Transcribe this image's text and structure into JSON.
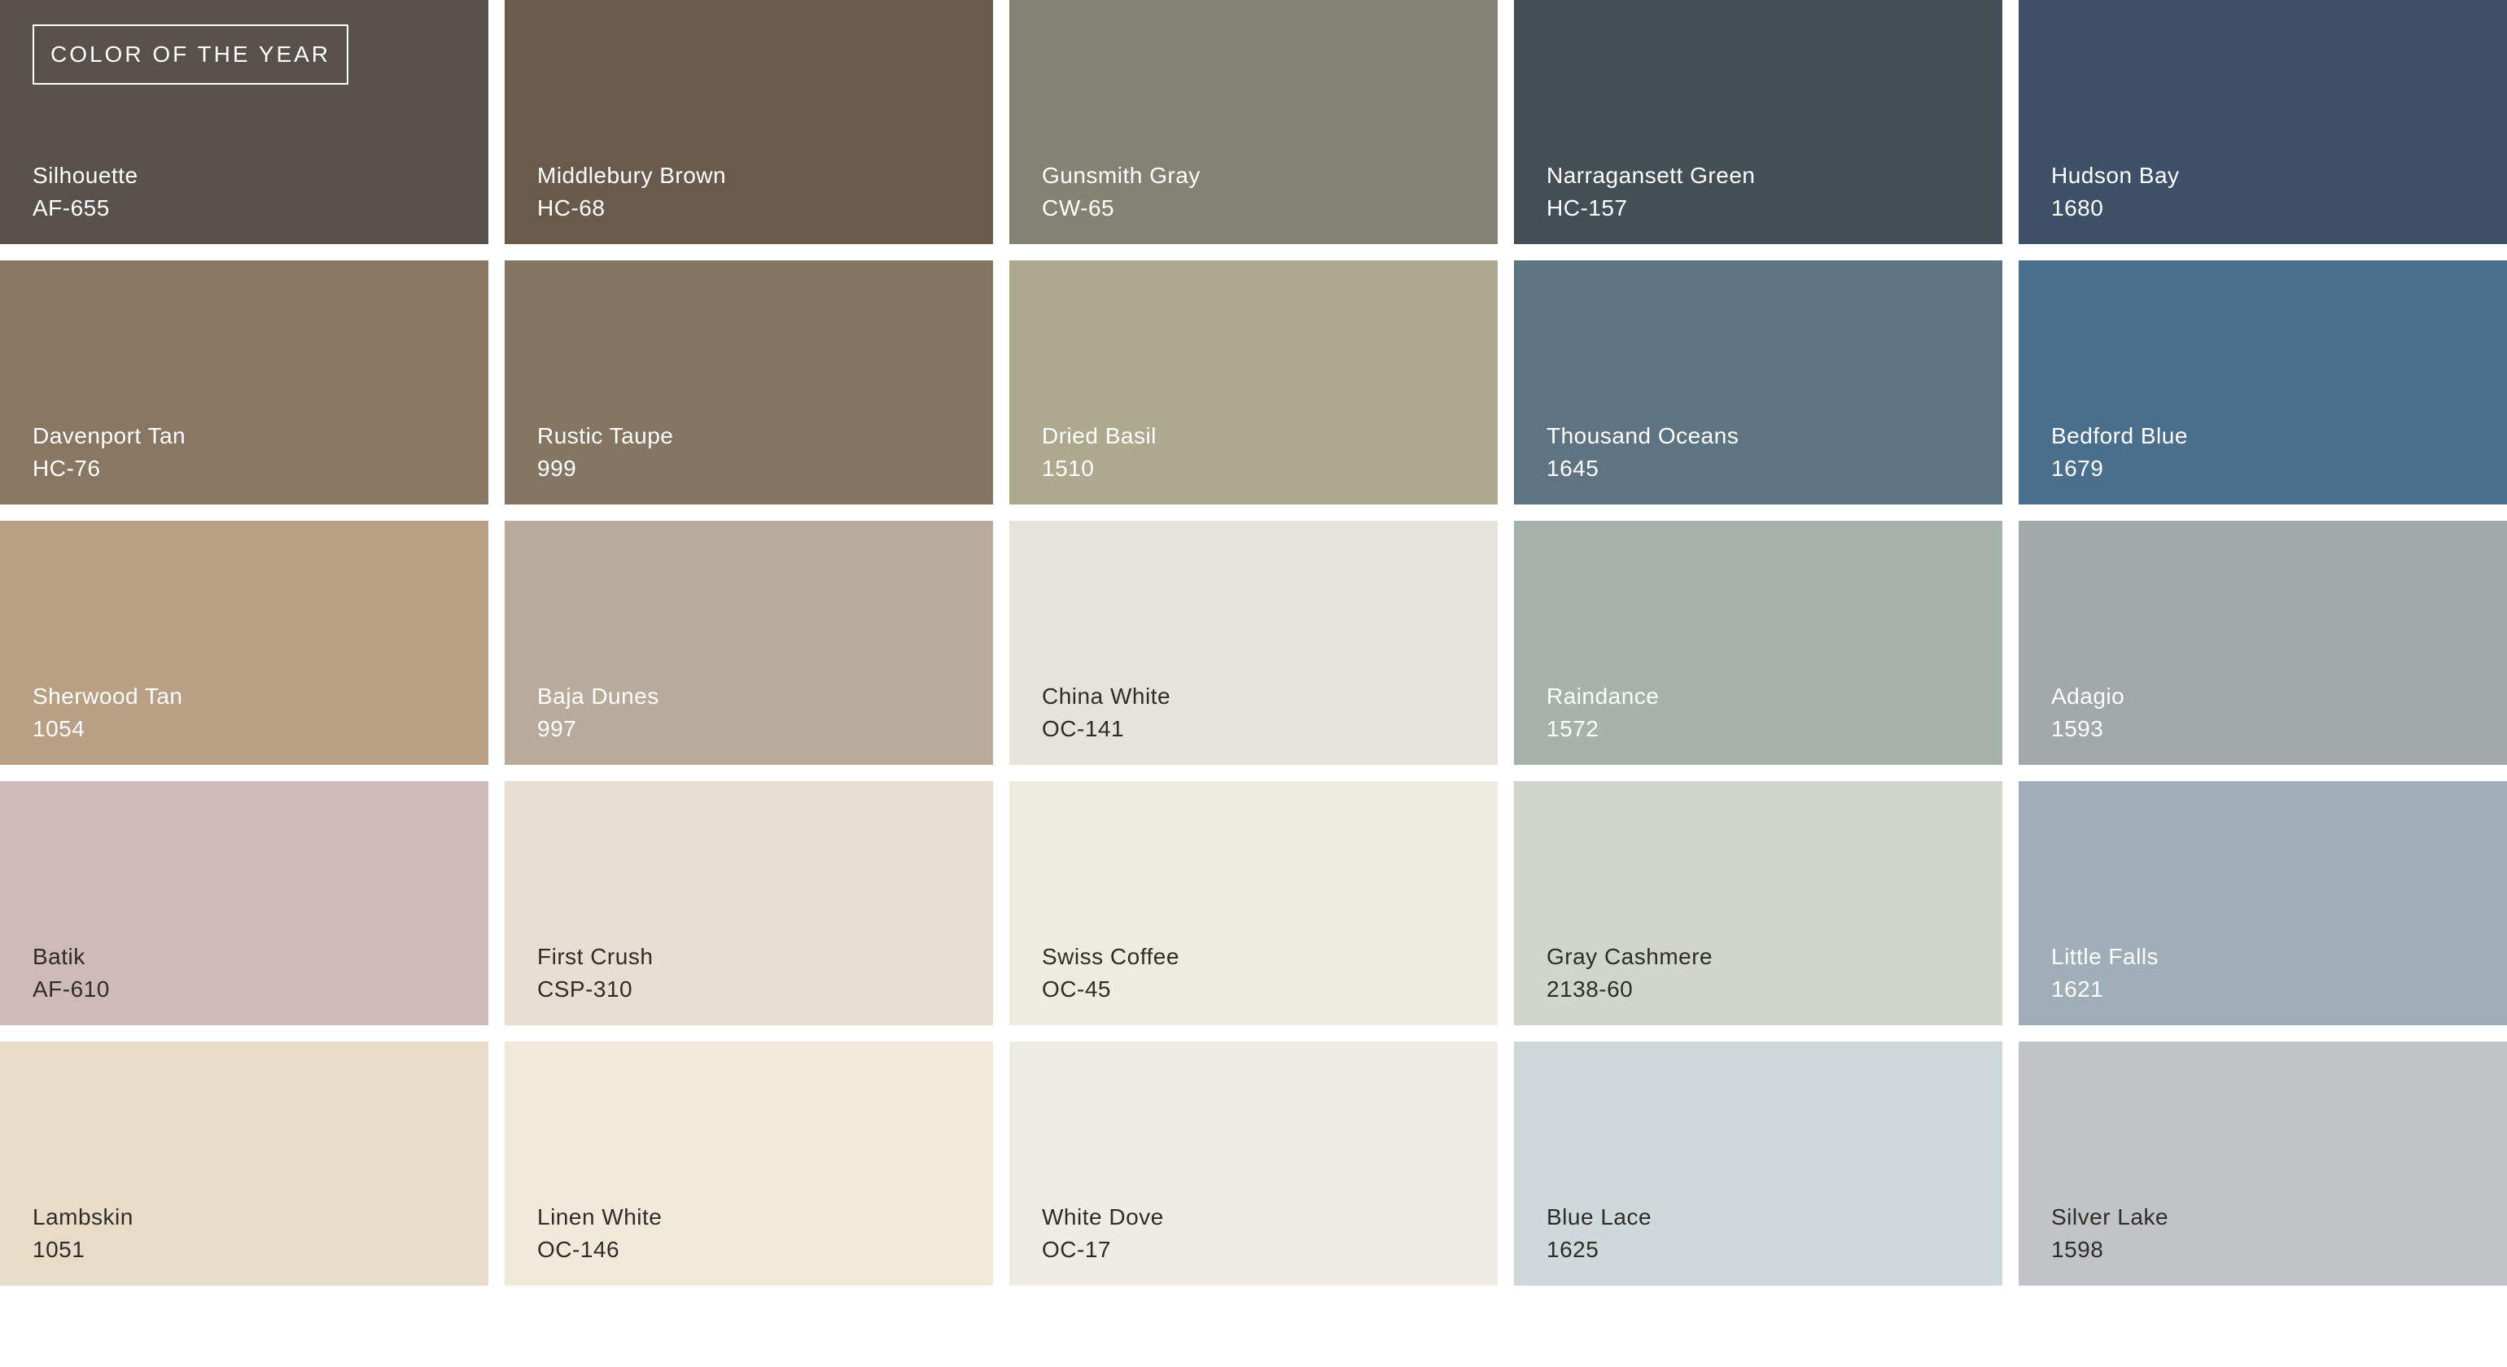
{
  "badge": {
    "text": "COLOR OF THE YEAR"
  },
  "swatches": [
    {
      "name": "Silhouette",
      "code": "AF-655",
      "color": "#57504b",
      "tone": "dark"
    },
    {
      "name": "Middlebury Brown",
      "code": "HC-68",
      "color": "#6a5a4c",
      "tone": "dark"
    },
    {
      "name": "Gunsmith Gray",
      "code": "CW-65",
      "color": "#838374",
      "tone": "dark"
    },
    {
      "name": "Narragansett Green",
      "code": "HC-157",
      "color": "#434f55",
      "tone": "dark"
    },
    {
      "name": "Hudson Bay",
      "code": "1680",
      "color": "#3d5068",
      "tone": "dark"
    },
    {
      "name": "Davenport Tan",
      "code": "HC-76",
      "color": "#8a7763",
      "tone": "dark"
    },
    {
      "name": "Rustic Taupe",
      "code": "999",
      "color": "#847663",
      "tone": "dark"
    },
    {
      "name": "Dried Basil",
      "code": "1510",
      "color": "#ada98e",
      "tone": "dark"
    },
    {
      "name": "Thousand Oceans",
      "code": "1645",
      "color": "#5e7482",
      "tone": "dark"
    },
    {
      "name": "Bedford Blue",
      "code": "1679",
      "color": "#4a6f8c",
      "tone": "dark"
    },
    {
      "name": "Sherwood Tan",
      "code": "1054",
      "color": "#b99f83",
      "tone": "dark"
    },
    {
      "name": "Baja Dunes",
      "code": "997",
      "color": "#b8ab9b",
      "tone": "dark"
    },
    {
      "name": "China White",
      "code": "OC-141",
      "color": "#e6e4da",
      "tone": "light"
    },
    {
      "name": "Raindance",
      "code": "1572",
      "color": "#a7b2aa",
      "tone": "dark"
    },
    {
      "name": "Adagio",
      "code": "1593",
      "color": "#a1a8a7",
      "tone": "dark"
    },
    {
      "name": "Batik",
      "code": "AF-610",
      "color": "#cdbab9",
      "tone": "light"
    },
    {
      "name": "First Crush",
      "code": "CSP-310",
      "color": "#e8ded2",
      "tone": "light"
    },
    {
      "name": "Swiss Coffee",
      "code": "OC-45",
      "color": "#eeebe1",
      "tone": "light"
    },
    {
      "name": "Gray Cashmere",
      "code": "2138-60",
      "color": "#d0d5cd",
      "tone": "light"
    },
    {
      "name": "Little Falls",
      "code": "1621",
      "color": "#a0aeb9",
      "tone": "dark"
    },
    {
      "name": "Lambskin",
      "code": "1051",
      "color": "#e8dcc8",
      "tone": "light"
    },
    {
      "name": "Linen White",
      "code": "OC-146",
      "color": "#f1e9da",
      "tone": "light"
    },
    {
      "name": "White Dove",
      "code": "OC-17",
      "color": "#edede6",
      "tone": "light"
    },
    {
      "name": "Blue Lace",
      "code": "1625",
      "color": "#cfd8db",
      "tone": "light"
    },
    {
      "name": "Silver Lake",
      "code": "1598",
      "color": "#c0c4c4",
      "tone": "light"
    }
  ]
}
